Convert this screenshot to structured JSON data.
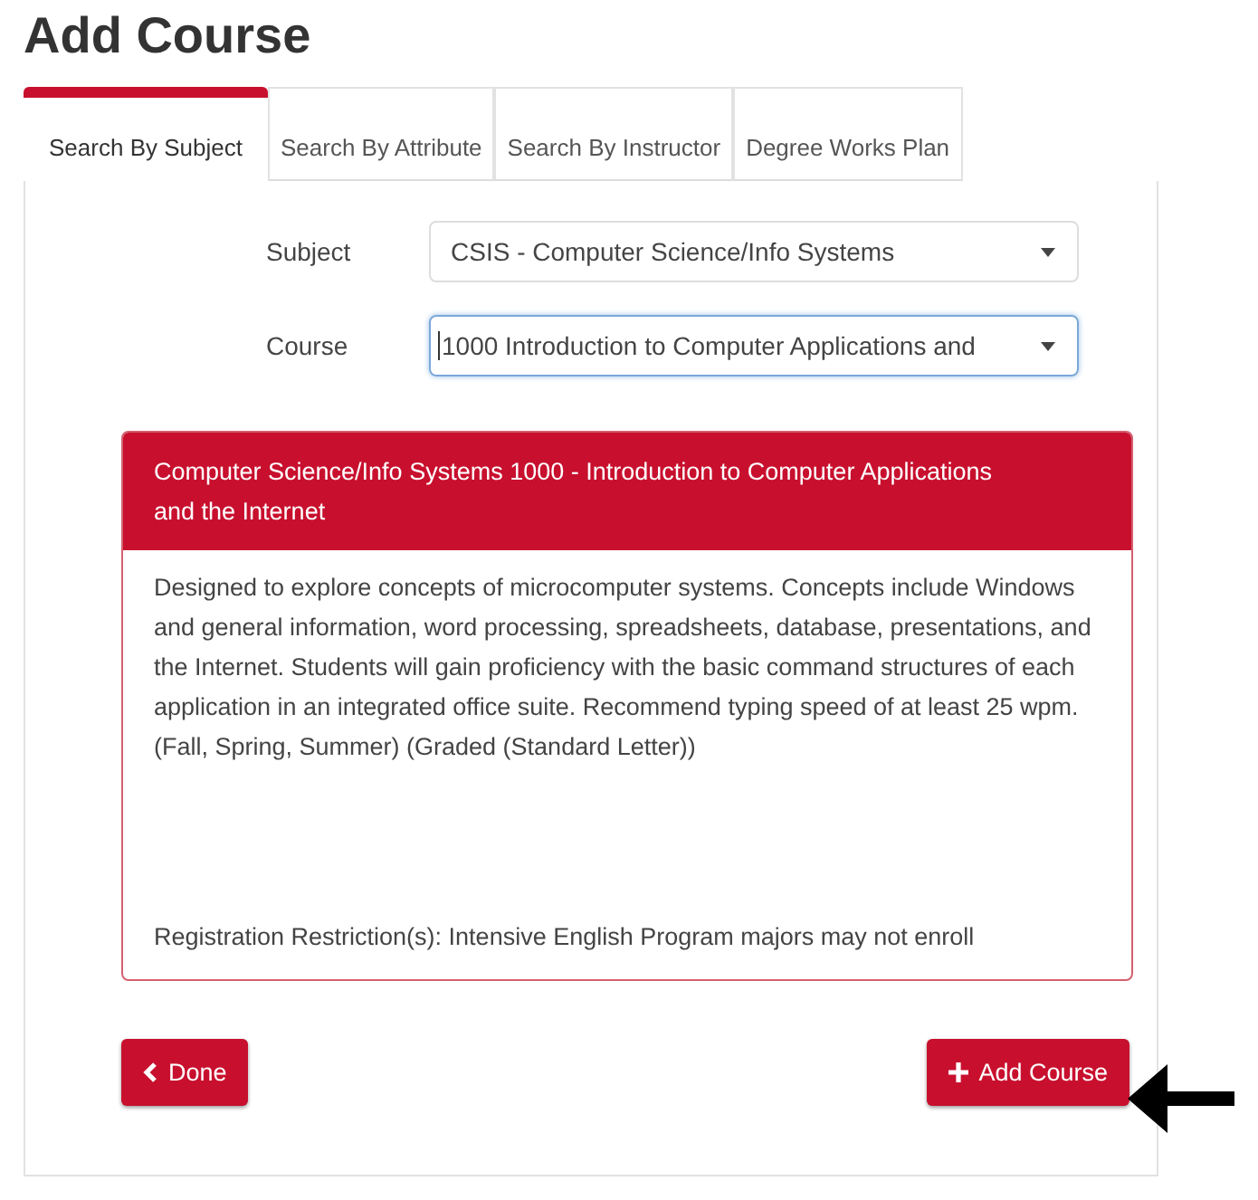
{
  "title": "Add Course",
  "tabs": [
    {
      "label": "Search By Subject",
      "selected": true
    },
    {
      "label": "Search By Attribute",
      "selected": false
    },
    {
      "label": "Search By Instructor",
      "selected": false
    },
    {
      "label": "Degree Works Plan",
      "selected": false
    }
  ],
  "fields": [
    {
      "label": "Subject",
      "value": "CSIS - Computer Science/Info Systems",
      "focused": false
    },
    {
      "label": "Course",
      "value": "1000 Introduction to Computer Applications and",
      "focused": true
    }
  ],
  "course_card": {
    "title": "Computer Science/Info Systems 1000 - Introduction to Computer Applications and the Internet",
    "description": "Designed to explore concepts of microcomputer systems. Concepts include Windows and general information, word processing, spreadsheets, database, presentations, and the Internet. Students will gain proficiency with the basic command structures of each application in an integrated office suite. Recommend typing speed of at least 25 wpm. (Fall, Spring, Summer) (Graded (Standard Letter))",
    "restriction": "Registration Restriction(s): Intensive English Program majors may not enroll"
  },
  "buttons": [
    {
      "label": "Done",
      "kind": "back"
    },
    {
      "label": "Add Course",
      "kind": "add"
    }
  ]
}
